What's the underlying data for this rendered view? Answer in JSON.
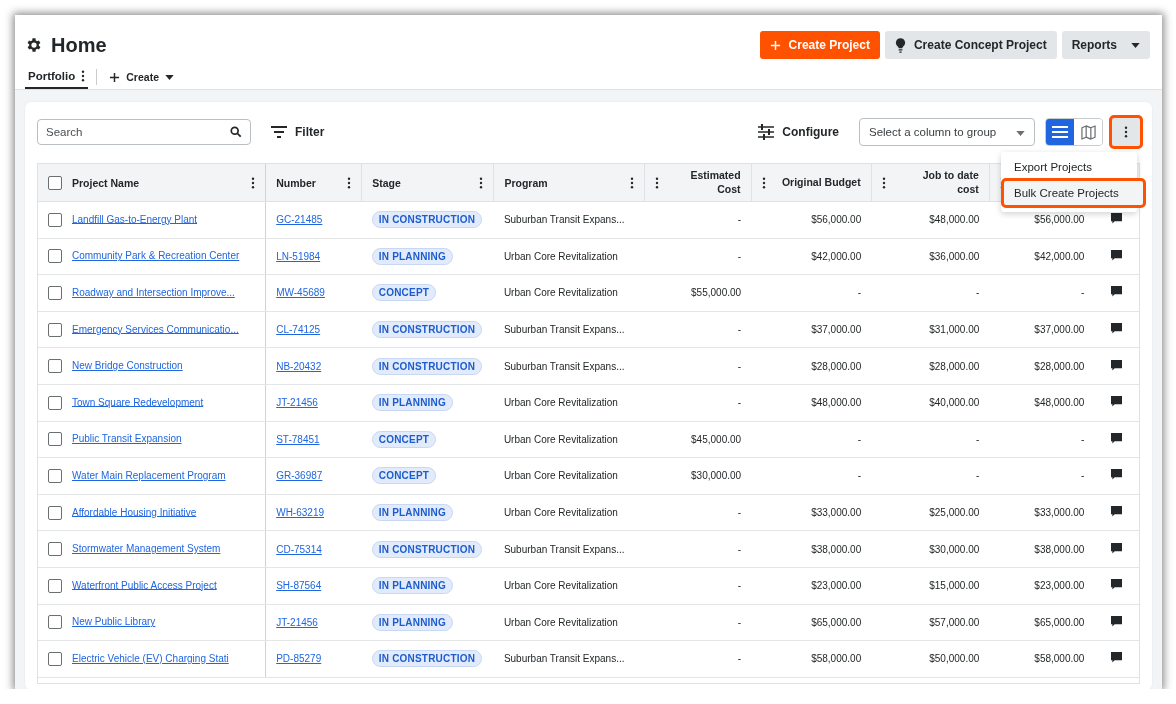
{
  "page": {
    "title": "Home"
  },
  "tabs": [
    {
      "label": "Portfolio",
      "selected": true,
      "kind": "tab"
    },
    {
      "label": "Create",
      "selected": false,
      "kind": "dropdown"
    }
  ],
  "header_buttons": [
    {
      "label": "Create Project",
      "kind": "primary"
    },
    {
      "label": "Create Concept Project",
      "kind": "concept"
    },
    {
      "label": "Reports",
      "kind": "dropdown"
    }
  ],
  "toolbar": {
    "search": {
      "placeholder": "Search"
    },
    "filter": "Filter",
    "configure": "Configure",
    "group_select": {
      "placeholder": "Select a column to group"
    },
    "views": [
      {
        "kind": "list",
        "selected": true
      },
      {
        "kind": "map",
        "selected": false
      }
    ],
    "more_button": {
      "highlighted": true
    }
  },
  "menu": {
    "items": [
      {
        "label": "Export Projects",
        "highlighted": false
      },
      {
        "label": "Bulk Create Projects",
        "highlighted": true
      }
    ]
  },
  "table": {
    "all_checked": false,
    "columns": [
      {
        "label": "Project Name",
        "kind": "text"
      },
      {
        "label": "Number",
        "kind": "text"
      },
      {
        "label": "Stage",
        "kind": "text"
      },
      {
        "label": "Program",
        "kind": "text"
      },
      {
        "label": "Estimated Cost",
        "kind": "money"
      },
      {
        "label": "Original Budget",
        "kind": "money"
      },
      {
        "label": "Job to date cost",
        "kind": "money"
      },
      {
        "kind": "money"
      }
    ],
    "rows": [
      {
        "name": "Landfill Gas-to-Energy Plant",
        "number": "GC-21485",
        "stage": "IN CONSTRUCTION",
        "program": "Suburban Transit Expans...",
        "estimated_cost": "-",
        "original_budget": "$56,000.00",
        "job_to_date_cost": "$48,000.00",
        "column_8": "$56,000.00",
        "checked": false
      },
      {
        "name": "Community Park & Recreation Center",
        "number": "LN-51984",
        "stage": "IN PLANNING",
        "program": "Urban Core Revitalization",
        "estimated_cost": "-",
        "original_budget": "$42,000.00",
        "job_to_date_cost": "$36,000.00",
        "column_8": "$42,000.00",
        "checked": false
      },
      {
        "name": "Roadway and Intersection Improve...",
        "number": "MW-45689",
        "stage": "CONCEPT",
        "program": "Urban Core Revitalization",
        "estimated_cost": "$55,000.00",
        "original_budget": "-",
        "job_to_date_cost": "-",
        "column_8": "-",
        "checked": false
      },
      {
        "name": "Emergency Services Communicatio...",
        "number": "CL-74125",
        "stage": "IN CONSTRUCTION",
        "program": "Suburban Transit Expans...",
        "estimated_cost": "-",
        "original_budget": "$37,000.00",
        "job_to_date_cost": "$31,000.00",
        "column_8": "$37,000.00",
        "checked": false
      },
      {
        "name": "New Bridge Construction",
        "number": "NB-20432",
        "stage": "IN CONSTRUCTION",
        "program": "Suburban Transit Expans...",
        "estimated_cost": "-",
        "original_budget": "$28,000.00",
        "job_to_date_cost": "$28,000.00",
        "column_8": "$28,000.00",
        "checked": false
      },
      {
        "name": "Town Square Redevelopment",
        "number": "JT-21456",
        "stage": "IN PLANNING",
        "program": "Urban Core Revitalization",
        "estimated_cost": "-",
        "original_budget": "$48,000.00",
        "job_to_date_cost": "$40,000.00",
        "column_8": "$48,000.00",
        "checked": false
      },
      {
        "name": "Public Transit Expansion",
        "number": "ST-78451",
        "stage": "CONCEPT",
        "program": "Urban Core Revitalization",
        "estimated_cost": "$45,000.00",
        "original_budget": "-",
        "job_to_date_cost": "-",
        "column_8": "-",
        "checked": false
      },
      {
        "name": "Water Main Replacement Program",
        "number": "GR-36987",
        "stage": "CONCEPT",
        "program": "Urban Core Revitalization",
        "estimated_cost": "$30,000.00",
        "original_budget": "-",
        "job_to_date_cost": "-",
        "column_8": "-",
        "checked": false
      },
      {
        "name": "Affordable Housing Initiative",
        "number": "WH-63219",
        "stage": "IN PLANNING",
        "program": "Urban Core Revitalization",
        "estimated_cost": "-",
        "original_budget": "$33,000.00",
        "job_to_date_cost": "$25,000.00",
        "column_8": "$33,000.00",
        "checked": false
      },
      {
        "name": "Stormwater Management System",
        "number": "CD-75314",
        "stage": "IN CONSTRUCTION",
        "program": "Suburban Transit Expans...",
        "estimated_cost": "-",
        "original_budget": "$38,000.00",
        "job_to_date_cost": "$30,000.00",
        "column_8": "$38,000.00",
        "checked": false
      },
      {
        "name": "Waterfront Public Access Project",
        "number": "SH-87564",
        "stage": "IN PLANNING",
        "program": "Urban Core Revitalization",
        "estimated_cost": "-",
        "original_budget": "$23,000.00",
        "job_to_date_cost": "$15,000.00",
        "column_8": "$23,000.00",
        "checked": false
      },
      {
        "name": "New Public Library",
        "number": "JT-21456",
        "stage": "IN PLANNING",
        "program": "Urban Core Revitalization",
        "estimated_cost": "-",
        "original_budget": "$65,000.00",
        "job_to_date_cost": "$57,000.00",
        "column_8": "$65,000.00",
        "checked": false
      },
      {
        "name": "Electric Vehicle (EV) Charging Stati",
        "number": "PD-85279",
        "stage": "IN CONSTRUCTION",
        "program": "Suburban Transit Expans...",
        "estimated_cost": "-",
        "original_budget": "$58,000.00",
        "job_to_date_cost": "$50,000.00",
        "column_8": "$58,000.00",
        "checked": false
      }
    ]
  }
}
